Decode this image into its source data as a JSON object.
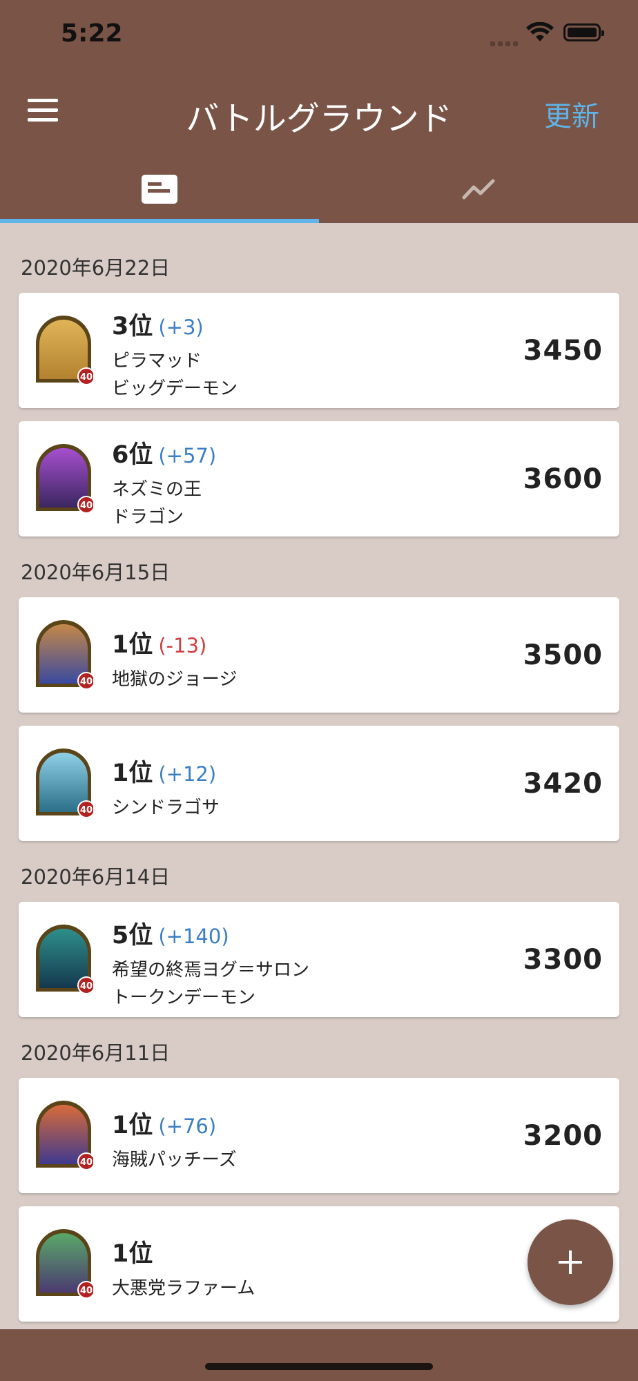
{
  "status_bar": {
    "time": "5:22"
  },
  "app_bar": {
    "title": "バトルグラウンド",
    "refresh_label": "更新"
  },
  "tabs": [
    {
      "icon": "card-icon",
      "selected": true
    },
    {
      "icon": "line-chart-icon",
      "selected": false
    }
  ],
  "groups": [
    {
      "date": "2020年6月22日",
      "entries": [
        {
          "rank": "3位",
          "delta": "(+3)",
          "line1": "ピラマッド",
          "line2": "ビッグデーモン",
          "score": "3450",
          "hero_level": "40",
          "portrait_colors": [
            "#e0b458",
            "#b38230"
          ]
        },
        {
          "rank": "6位",
          "delta": "(+57)",
          "line1": "ネズミの王",
          "line2": "ドラゴン",
          "score": "3600",
          "hero_level": "40",
          "portrait_colors": [
            "#a64fcf",
            "#3b2761"
          ]
        }
      ]
    },
    {
      "date": "2020年6月15日",
      "entries": [
        {
          "rank": "1位",
          "delta": "(-13)",
          "line1": "地獄のジョージ",
          "line2": "",
          "score": "3500",
          "hero_level": "40",
          "portrait_colors": [
            "#c58848",
            "#3a4aa0"
          ]
        },
        {
          "rank": "1位",
          "delta": "(+12)",
          "line1": "シンドラゴサ",
          "line2": "",
          "score": "3420",
          "hero_level": "40",
          "portrait_colors": [
            "#8fd0e6",
            "#2b6f88"
          ]
        }
      ]
    },
    {
      "date": "2020年6月14日",
      "entries": [
        {
          "rank": "5位",
          "delta": "(+140)",
          "line1": "希望の終焉ヨグ＝サロン",
          "line2": "トークンデーモン",
          "score": "3300",
          "hero_level": "40",
          "portrait_colors": [
            "#2e8f8a",
            "#15384e"
          ]
        }
      ]
    },
    {
      "date": "2020年6月11日",
      "entries": [
        {
          "rank": "1位",
          "delta": "(+76)",
          "line1": "海賊パッチーズ",
          "line2": "",
          "score": "3200",
          "hero_level": "40",
          "portrait_colors": [
            "#d86b3a",
            "#3f3a8f"
          ]
        },
        {
          "rank": "1位",
          "delta": "",
          "line1": "大悪党ラファーム",
          "line2": "",
          "score": "",
          "hero_level": "40",
          "portrait_colors": [
            "#5aa86a",
            "#4b3a70"
          ]
        }
      ]
    }
  ],
  "fab": {
    "icon": "plus-icon"
  }
}
